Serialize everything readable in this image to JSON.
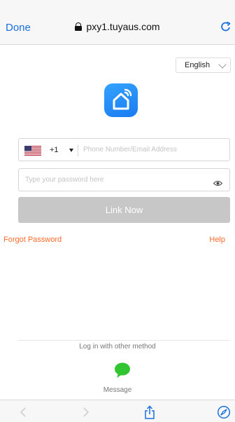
{
  "browser": {
    "done_label": "Done",
    "url": "pxy1.tuyaus.com",
    "colors": {
      "accent": "#1a6fe0",
      "chrome_bg": "#f7f7f7"
    }
  },
  "language": {
    "selected": "English"
  },
  "login": {
    "country_code": "+1",
    "phone_placeholder": "Phone Number/Email Address",
    "password_placeholder": "Type your password here",
    "submit_label": "Link Now",
    "forgot_label": "Forgot Password",
    "help_label": "Help",
    "colors": {
      "link_orange": "#ff6a2a",
      "button_disabled": "#c7c7c7",
      "logo_blue": "#1b7bf0"
    }
  },
  "other_methods": {
    "title": "Log in with other method",
    "message_label": "Message",
    "colors": {
      "message_green": "#32c532"
    }
  },
  "icons": [
    "lock-icon",
    "reload-icon",
    "app-logo-icon",
    "us-flag-icon",
    "eye-icon",
    "message-icon",
    "back-icon",
    "forward-icon",
    "share-icon",
    "compass-icon"
  ]
}
